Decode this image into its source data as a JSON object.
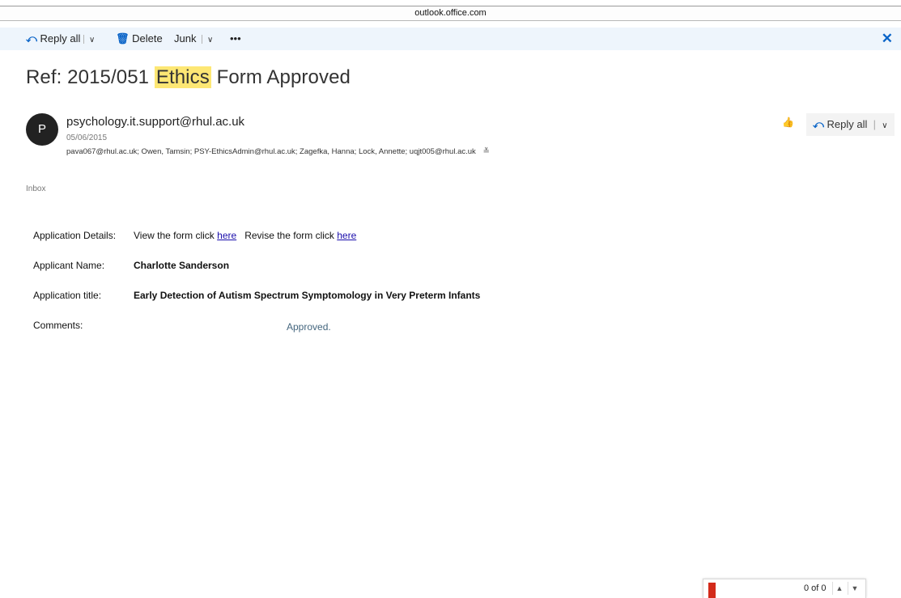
{
  "browser": {
    "url": "outlook.office.com"
  },
  "toolbar": {
    "reply_all_label": "Reply all",
    "delete_label": "Delete",
    "junk_label": "Junk",
    "more_label": "•••"
  },
  "message": {
    "subject_prefix": "Ref: 2015/051 ",
    "subject_highlight": "Ethics",
    "subject_suffix": " Form Approved",
    "avatar_letter": "P",
    "sender": "psychology.it.support@rhul.ac.uk",
    "date": "05/06/2015",
    "recipients": "pava067@rhul.ac.uk; Owen, Tamsin; PSY-EthicsAdmin@rhul.ac.uk; Zagefka, Hanna; Lock, Annette; uqjt005@rhul.ac.uk",
    "reply_all_label": "Reply all",
    "folder": "Inbox"
  },
  "body": {
    "details_label": "Application Details:",
    "view_text": "View the form click ",
    "view_link": "here",
    "revise_text": "Revise the form click ",
    "revise_link": "here",
    "name_label": "Applicant Name:",
    "name_value": "Charlotte Sanderson",
    "title_label": "Application title:",
    "title_value": "Early Detection of Autism Spectrum Symptomology in Very Preterm Infants",
    "comments_label": "Comments:",
    "comments_value": "Approved."
  },
  "find_bar": {
    "count": "0 of 0"
  },
  "icons": {
    "reply_all": "reply-all-icon",
    "delete": "trash-icon",
    "close": "close-icon",
    "like": "thumbs-up-icon",
    "expand": "chevron-double-down-icon"
  },
  "colors": {
    "accent": "#0a64c8",
    "highlight": "#fde774",
    "toolbar_bg": "#eef5fc",
    "find_marker": "#d32a1a"
  }
}
